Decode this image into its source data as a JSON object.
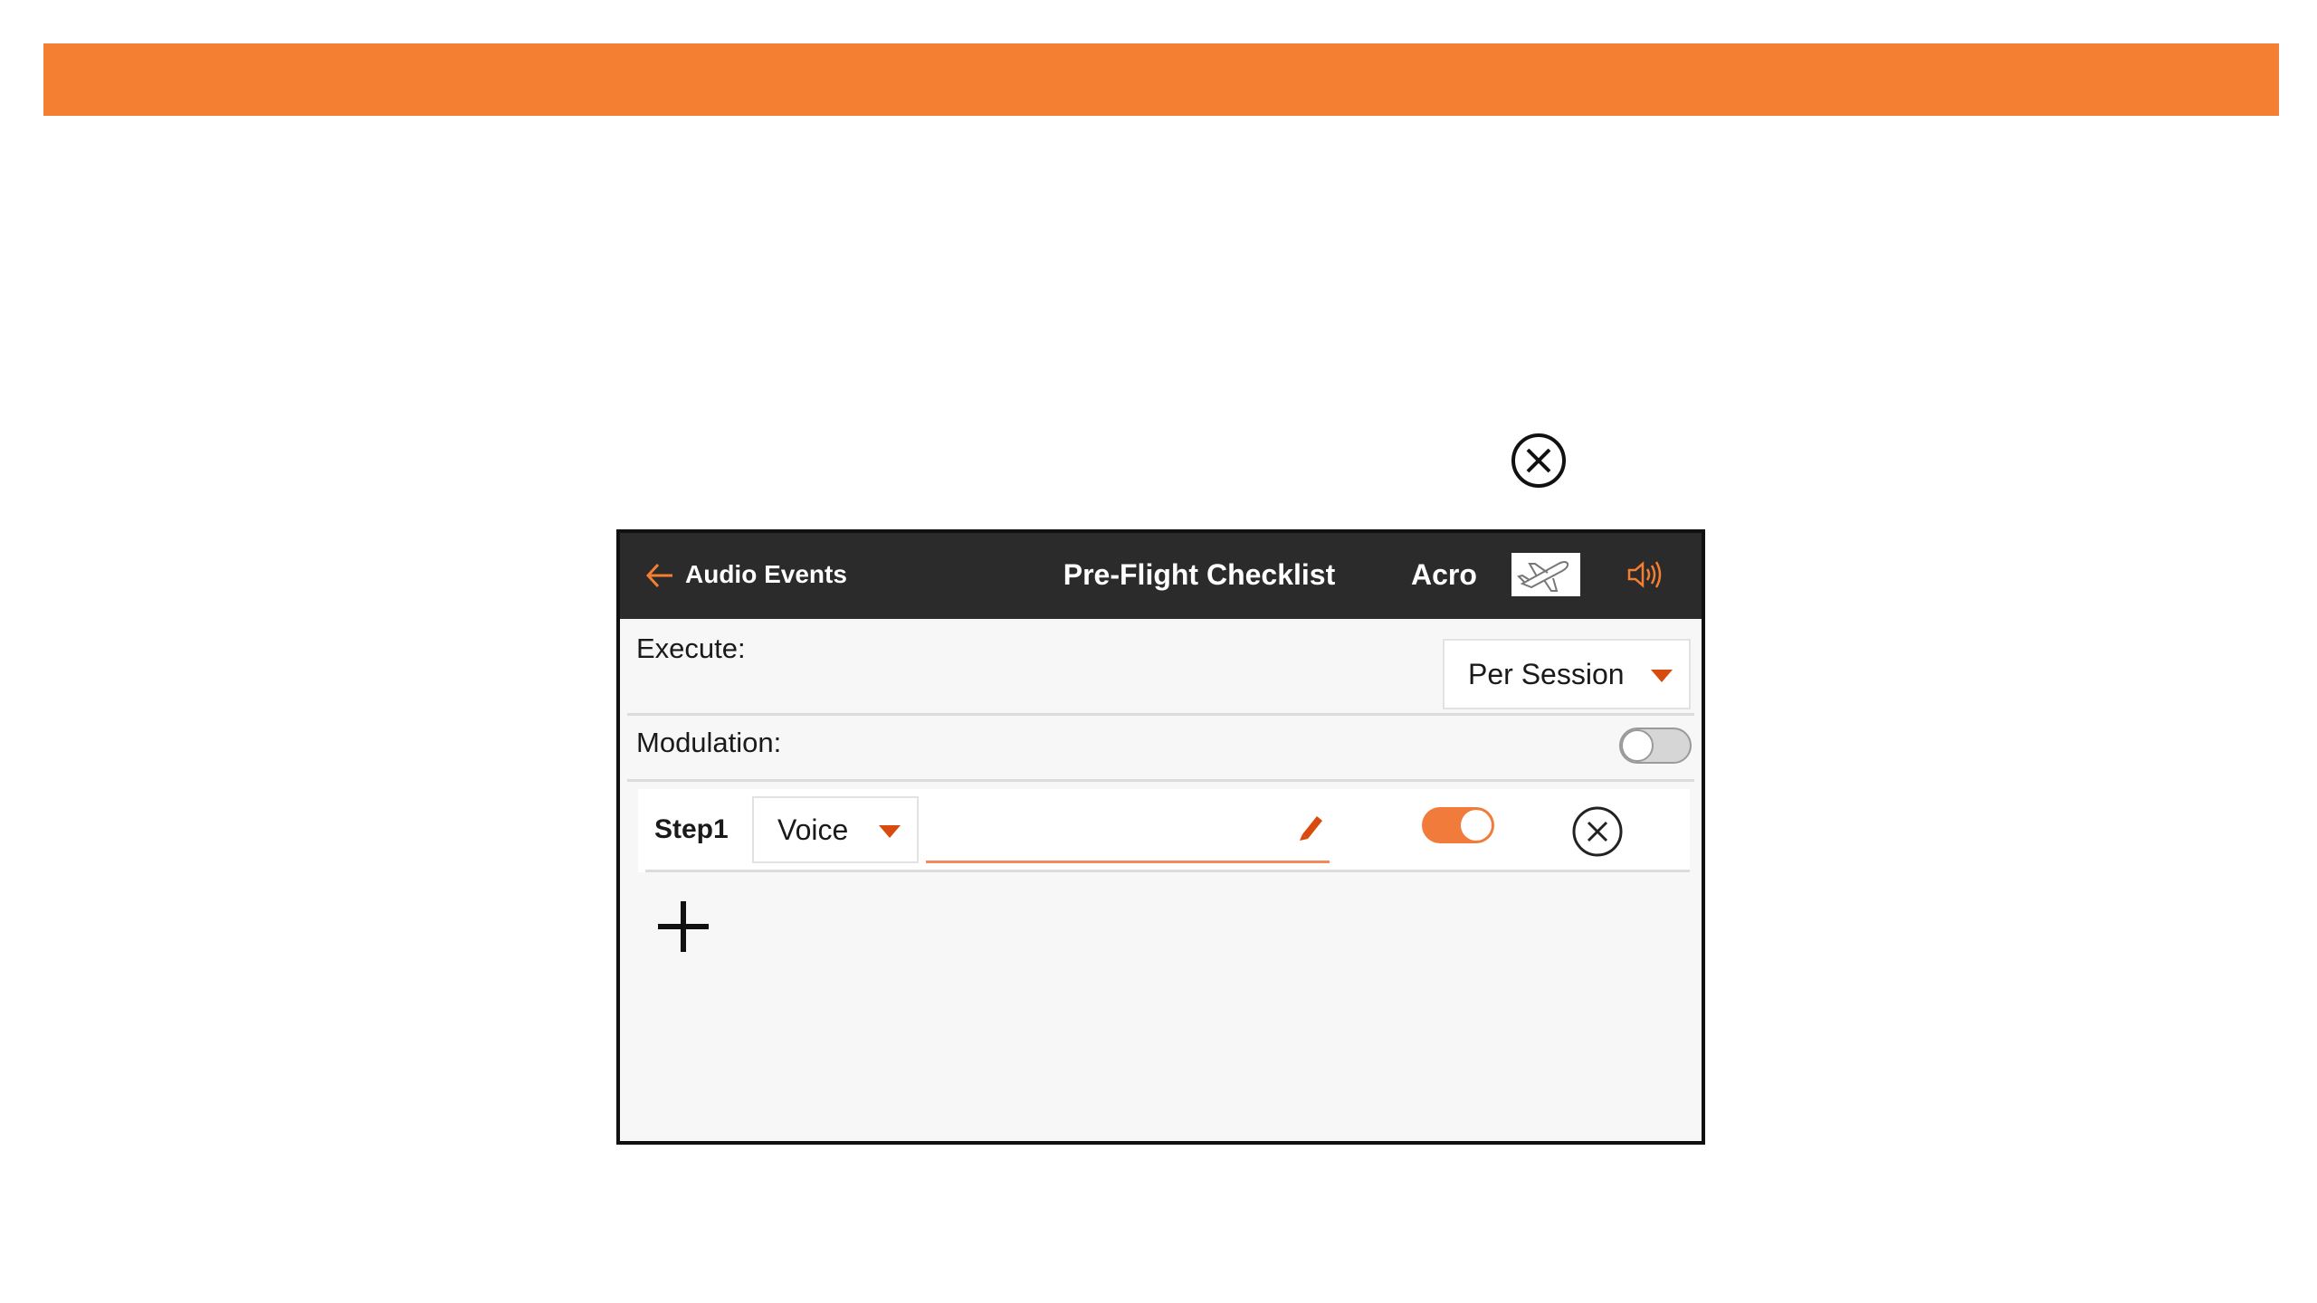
{
  "colors": {
    "accent": "#f47f32",
    "titlebar": "#2b2b2b",
    "content_bg": "#f7f7f7",
    "toggle_on": "#f07b3a",
    "dropdown_caret": "#d84b0f",
    "text": "#1a1a1a"
  },
  "floating": {
    "close_icon": "circle-x-icon"
  },
  "titlebar": {
    "back_icon": "arrow-left-icon",
    "back_label": "Audio Events",
    "title": "Pre-Flight Checklist",
    "model_name": "Acro",
    "model_icon": "airplane-icon",
    "speaker_icon": "speaker-icon"
  },
  "execute": {
    "label": "Execute:",
    "value": "Per Session",
    "caret_icon": "caret-down-icon"
  },
  "modulation": {
    "label": "Modulation:",
    "enabled": false
  },
  "steps": [
    {
      "label": "Step1",
      "type": "Voice",
      "text_value": "",
      "enabled": true,
      "edit_icon": "pencil-icon",
      "remove_icon": "circle-x-icon"
    }
  ],
  "add_step_icon": "plus-icon"
}
